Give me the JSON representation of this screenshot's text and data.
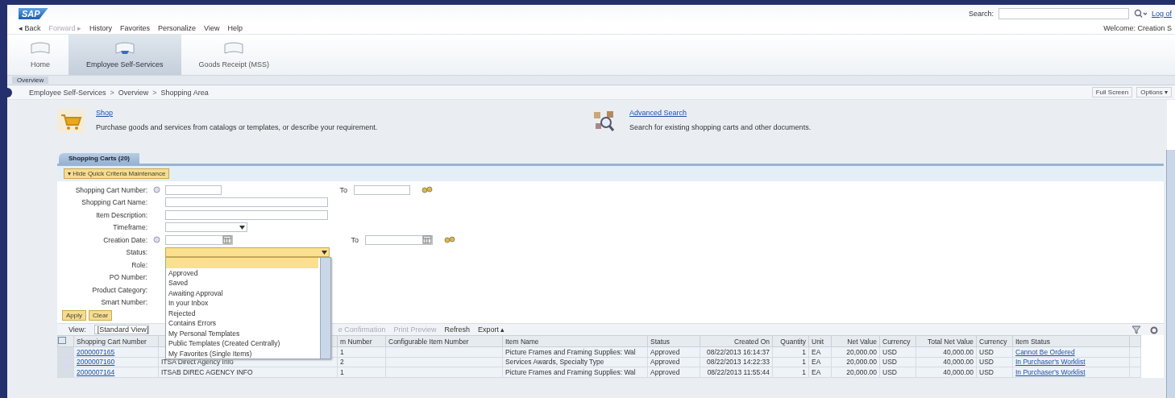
{
  "header": {
    "logo": "SAP",
    "search_label": "Search:",
    "log_off": "Log of",
    "welcome": "Welcome: Creation S"
  },
  "menu": [
    {
      "label": "◂ Back",
      "disabled": false
    },
    {
      "label": "Forward ▸",
      "disabled": true
    },
    {
      "label": "History",
      "disabled": false
    },
    {
      "label": "Favorites",
      "disabled": false
    },
    {
      "label": "Personalize",
      "disabled": false
    },
    {
      "label": "View",
      "disabled": false
    },
    {
      "label": "Help",
      "disabled": false
    }
  ],
  "nav_tabs": [
    {
      "label": "Home",
      "selected": false
    },
    {
      "label": "Employee Self-Services",
      "selected": true
    },
    {
      "label": "Goods Receipt (MSS)",
      "selected": false
    }
  ],
  "sub_tab": "Overview",
  "breadcrumb": [
    "Employee Self-Services",
    "Overview",
    "Shopping Area"
  ],
  "breadcrumb_separator": ">",
  "page_actions": [
    "Full Screen",
    "Options ▾"
  ],
  "services": [
    {
      "kind": "cart",
      "title": "Shop",
      "description": "Purchase goods and services from catalogs or templates, or describe your requirement."
    },
    {
      "kind": "search",
      "title": "Advanced Search",
      "description": "Search for existing shopping carts and other documents."
    }
  ],
  "tab": "Shopping Carts (20)",
  "criteria_toggle": "▾ Hide Quick Criteria Maintenance",
  "criteria": [
    {
      "label": "Shopping Cart Number:",
      "kind": "range",
      "to_label": "To"
    },
    {
      "label": "Shopping Cart Name:",
      "kind": "text"
    },
    {
      "label": "Item Description:",
      "kind": "text"
    },
    {
      "label": "Timeframe:",
      "kind": "select"
    },
    {
      "label": "Creation Date:",
      "kind": "date_range",
      "to_label": "To"
    },
    {
      "label": "Status:",
      "kind": "dropdown",
      "open": true,
      "options": [
        {
          "selected": true
        },
        {
          "label": "Approved",
          "selected": false
        },
        {
          "label": "Saved",
          "selected": false
        },
        {
          "label": "Awaiting Approval",
          "selected": false
        },
        {
          "label": "In your Inbox",
          "selected": false
        },
        {
          "label": "Rejected",
          "selected": false
        },
        {
          "label": "Contains Errors",
          "selected": false
        },
        {
          "label": "My Personal Templates",
          "selected": false
        },
        {
          "label": "Public Templates (Created Centrally)",
          "selected": false
        },
        {
          "label": "My Favorites (Single Items)",
          "selected": false
        }
      ]
    },
    {
      "label": "Role:"
    },
    {
      "label": "PO Number:"
    },
    {
      "label": "Product Category:"
    },
    {
      "label": "Smart Number:"
    }
  ],
  "criteria_buttons": [
    "Apply",
    "Clear"
  ],
  "toolbar": {
    "view_label": "View:",
    "view_value": "[Standard View]",
    "actions": [
      {
        "label": "e Confirmation",
        "disabled": true
      },
      {
        "label": "Print Preview",
        "disabled": true
      },
      {
        "label": "Refresh",
        "disabled": false
      },
      {
        "label": "Export ▴",
        "disabled": false
      }
    ]
  },
  "table": {
    "columns": [
      "Shopping Cart Number",
      "",
      "m Number",
      "Configurable Item Number",
      "Item Name",
      "Status",
      "Created On",
      "Quantity",
      "Unit",
      "Net Value",
      "Currency",
      "Total Net Value",
      "Currency",
      "Item Status"
    ],
    "rows": [
      [
        "2000007165",
        "",
        "1",
        "",
        "Picture Frames and Framing Supplies: Wal",
        "Approved",
        "08/22/2013 16:14:37",
        "1",
        "EA",
        "20,000.00",
        "USD",
        "40,000.00",
        "USD",
        "Cannot Be Ordered"
      ],
      [
        "2000007160",
        "ITSA Direct Agency Info",
        "2",
        "",
        "Services Awards, Specialty Type",
        "Approved",
        "08/22/2013 14:22:33",
        "1",
        "EA",
        "20,000.00",
        "USD",
        "40,000.00",
        "USD",
        "In Purchaser's Worklist"
      ],
      [
        "2000007164",
        "ITSAB DIREC AGENCY INFO",
        "1",
        "",
        "Picture Frames and Framing Supplies: Wal",
        "Approved",
        "08/22/2013 11:55:44",
        "1",
        "EA",
        "20,000.00",
        "USD",
        "40,000.00",
        "USD",
        "In Purchaser's Worklist"
      ]
    ]
  }
}
